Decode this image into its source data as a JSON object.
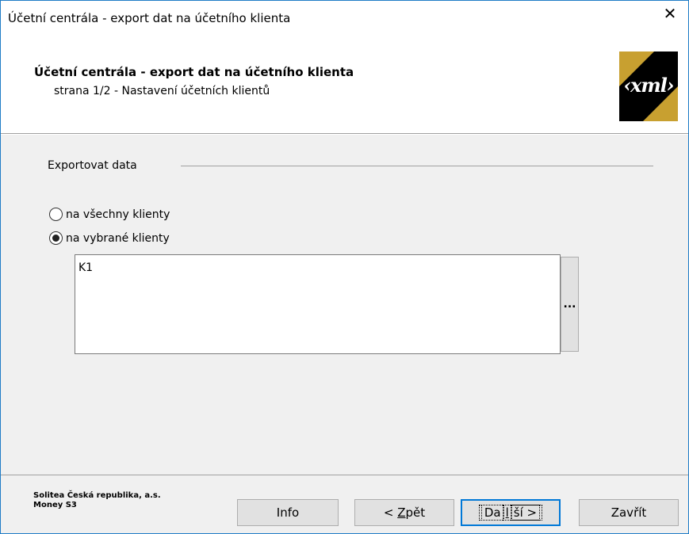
{
  "window": {
    "title": "Účetní centrála - export dat na účetního klienta",
    "close_glyph": "✕"
  },
  "header": {
    "title": "Účetní centrála - export dat na účetního klienta",
    "subtitle": "strana 1/2 - Nastavení účetních klientů",
    "logo_text": "‹xml›"
  },
  "export": {
    "group_label": "Exportovat data",
    "options": [
      {
        "label": "na všechny klienty",
        "checked": false
      },
      {
        "label": "na vybrané klienty",
        "checked": true
      }
    ],
    "selected_clients": [
      "K1"
    ],
    "browse_label": "..."
  },
  "footer": {
    "company_line1": "Solitea Česká republika, a.s.",
    "company_line2": "Money S3",
    "buttons": {
      "info": "Info",
      "back_prefix": "< ",
      "back_accel": "Z",
      "back_rest": "pět",
      "next_prefix": "Da",
      "next_accel": "l",
      "next_rest": "ší >",
      "close": "Zavřít"
    }
  },
  "colors": {
    "accent": "#0078d7",
    "logo_gold": "#c8a030",
    "panel": "#f0f0f0"
  }
}
